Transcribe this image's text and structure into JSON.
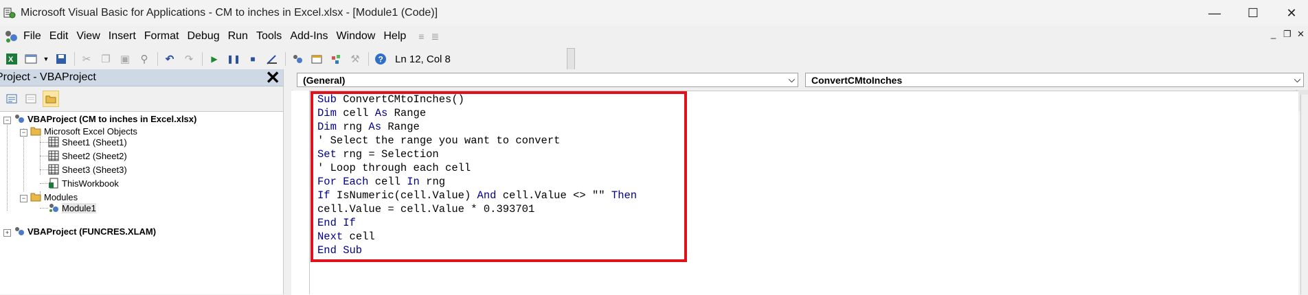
{
  "window": {
    "title": "Microsoft Visual Basic for Applications - CM to inches in Excel.xlsx - [Module1 (Code)]",
    "controls": {
      "minimize": "—",
      "maximize": "☐",
      "close": "✕"
    }
  },
  "menu": {
    "items": [
      {
        "label": "File"
      },
      {
        "label": "Edit"
      },
      {
        "label": "View"
      },
      {
        "label": "Insert"
      },
      {
        "label": "Format"
      },
      {
        "label": "Debug"
      },
      {
        "label": "Run"
      },
      {
        "label": "Tools"
      },
      {
        "label": "Add-Ins"
      },
      {
        "label": "Window"
      },
      {
        "label": "Help"
      }
    ],
    "mdi_controls": {
      "minimize": "_",
      "restore": "❐",
      "close": "✕"
    }
  },
  "toolbar": {
    "status": "Ln 12, Col 8",
    "icons": [
      "excel-icon",
      "insert-module-icon",
      "save-icon",
      "cut-icon",
      "copy-icon",
      "paste-icon",
      "find-icon",
      "undo-icon",
      "redo-icon",
      "run-icon",
      "break-icon",
      "reset-icon",
      "design-mode-icon",
      "project-explorer-icon",
      "properties-icon",
      "object-browser-icon",
      "toolbox-icon",
      "help-icon"
    ]
  },
  "project": {
    "title": "Project - VBAProject",
    "tree": {
      "root1": "VBAProject (CM to inches in Excel.xlsx)",
      "folder_objects": "Microsoft Excel Objects",
      "sheet1": "Sheet1 (Sheet1)",
      "sheet2": "Sheet2 (Sheet2)",
      "sheet3": "Sheet3 (Sheet3)",
      "workbook": "ThisWorkbook",
      "folder_modules": "Modules",
      "module1": "Module1",
      "root2": "VBAProject (FUNCRES.XLAM)"
    }
  },
  "code_window": {
    "object_combo": "(General)",
    "procedure_combo": "ConvertCMtoInches",
    "lines": [
      [
        {
          "t": "Sub",
          "k": true
        },
        {
          "t": " ConvertCMtoInches()"
        }
      ],
      [
        {
          "t": "Dim",
          "k": true
        },
        {
          "t": " cell "
        },
        {
          "t": "As",
          "k": true
        },
        {
          "t": " Range"
        }
      ],
      [
        {
          "t": "Dim",
          "k": true
        },
        {
          "t": " rng "
        },
        {
          "t": "As",
          "k": true
        },
        {
          "t": " Range"
        }
      ],
      [
        {
          "t": "' Select the range you want to convert"
        }
      ],
      [
        {
          "t": "Set",
          "k": true
        },
        {
          "t": " rng = Selection"
        }
      ],
      [
        {
          "t": "' Loop through each cell"
        }
      ],
      [
        {
          "t": "For Each",
          "k": true
        },
        {
          "t": " cell "
        },
        {
          "t": "In",
          "k": true
        },
        {
          "t": " rng"
        }
      ],
      [
        {
          "t": "If",
          "k": true
        },
        {
          "t": " IsNumeric(cell.Value) "
        },
        {
          "t": "And",
          "k": true
        },
        {
          "t": " cell.Value <> \"\" "
        },
        {
          "t": "Then",
          "k": true
        }
      ],
      [
        {
          "t": "cell.Value = cell.Value * 0.393701"
        }
      ],
      [
        {
          "t": "End If",
          "k": true
        }
      ],
      [
        {
          "t": "Next",
          "k": true
        },
        {
          "t": " cell"
        }
      ],
      [
        {
          "t": "End Sub",
          "k": true
        }
      ]
    ]
  },
  "colors": {
    "keyword": "#00008b",
    "highlight_border": "#e0111c",
    "project_header": "#cfd9e6"
  }
}
